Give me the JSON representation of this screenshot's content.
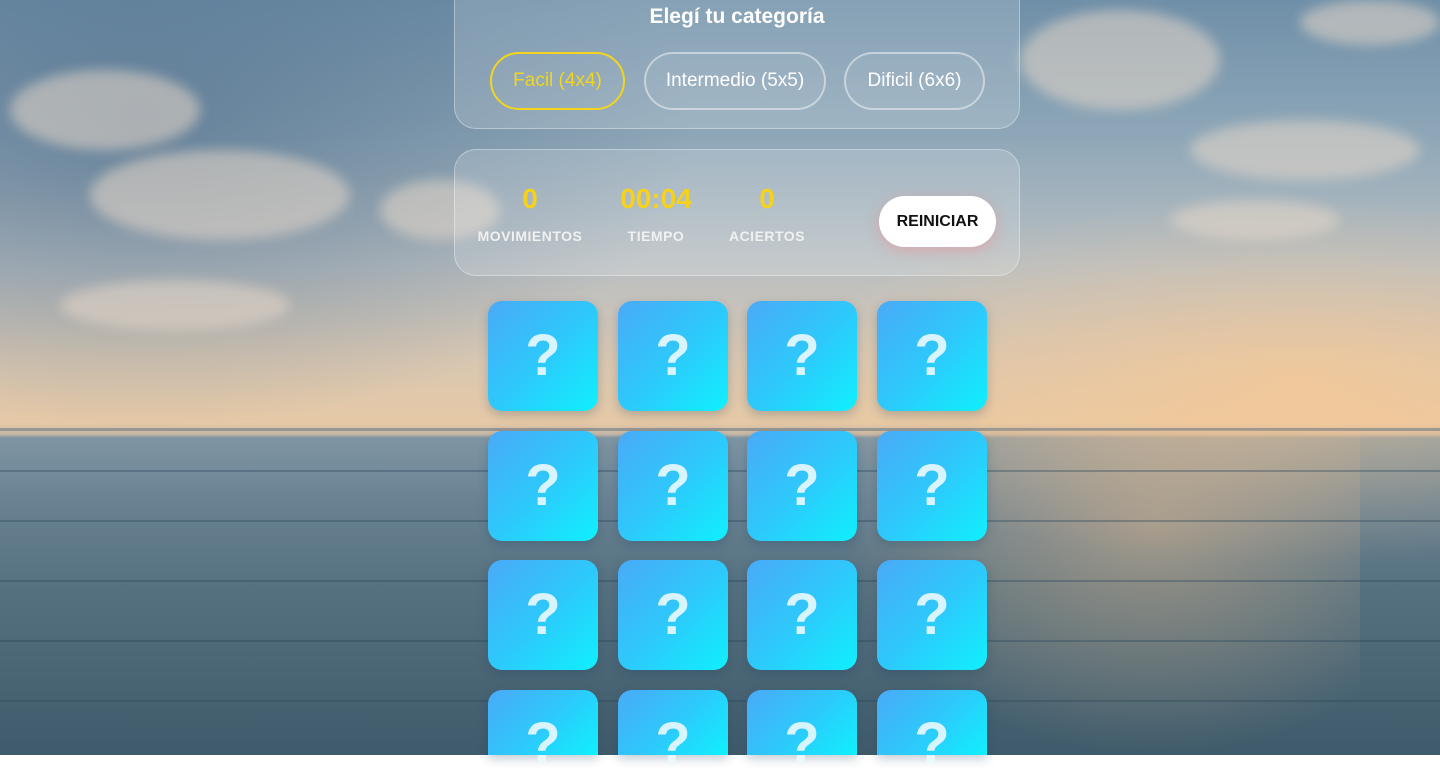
{
  "category": {
    "title": "Elegí tu categoría",
    "options": [
      {
        "label": "Facil (4x4)",
        "active": true
      },
      {
        "label": "Intermedio (5x5)",
        "active": false
      },
      {
        "label": "Dificil (6x6)",
        "active": false
      }
    ]
  },
  "stats": {
    "moves": {
      "value": "0",
      "label": "MOVIMIENTOS"
    },
    "time": {
      "value": "00:04",
      "label": "TIEMPO"
    },
    "hits": {
      "value": "0",
      "label": "ACIERTOS"
    },
    "restart_label": "REINICIAR"
  },
  "board": {
    "cards": [
      "?",
      "?",
      "?",
      "?",
      "?",
      "?",
      "?",
      "?",
      "?",
      "?",
      "?",
      "?",
      "?",
      "?",
      "?",
      "?"
    ]
  },
  "colors": {
    "accent": "#f2d51c",
    "card_gradient_start": "#4aaaf7",
    "card_gradient_end": "#0ff0fe"
  }
}
